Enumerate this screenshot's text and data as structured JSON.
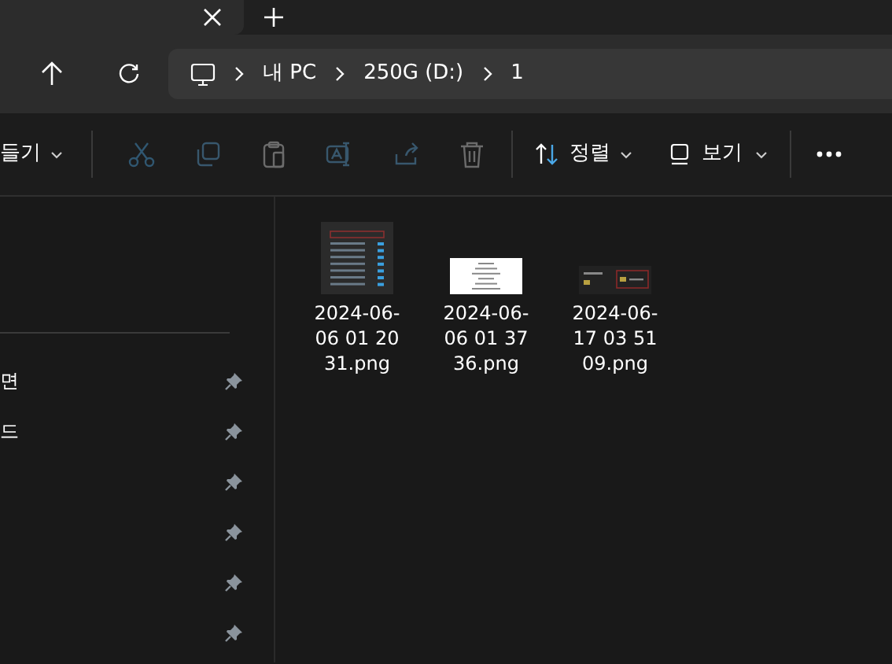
{
  "address": {
    "segments": [
      "내 PC",
      "250G (D:)",
      "1"
    ]
  },
  "toolbar": {
    "new_label": "들기",
    "actions": [
      {
        "kind": "cut",
        "disabled": true
      },
      {
        "kind": "copy",
        "disabled": true
      },
      {
        "kind": "paste",
        "disabled": true
      },
      {
        "kind": "rename",
        "disabled": true
      },
      {
        "kind": "share",
        "disabled": true
      },
      {
        "kind": "delete",
        "disabled": true
      }
    ],
    "sort_label": "정렬",
    "view_label": "보기"
  },
  "sidebar": {
    "items": [
      {
        "label": "면",
        "pinned": true
      },
      {
        "label": "드",
        "pinned": true
      },
      {
        "pinned": true
      },
      {
        "pinned": true
      },
      {
        "pinned": true
      },
      {
        "pinned": true
      }
    ]
  },
  "files": [
    {
      "name": "2024-06-06 01 20 31.png",
      "kind": "dark-list"
    },
    {
      "name": "2024-06-06 01 37 36.png",
      "kind": "white-doc"
    },
    {
      "name": "2024-06-17 03 51 09.png",
      "kind": "dark-wide"
    }
  ]
}
